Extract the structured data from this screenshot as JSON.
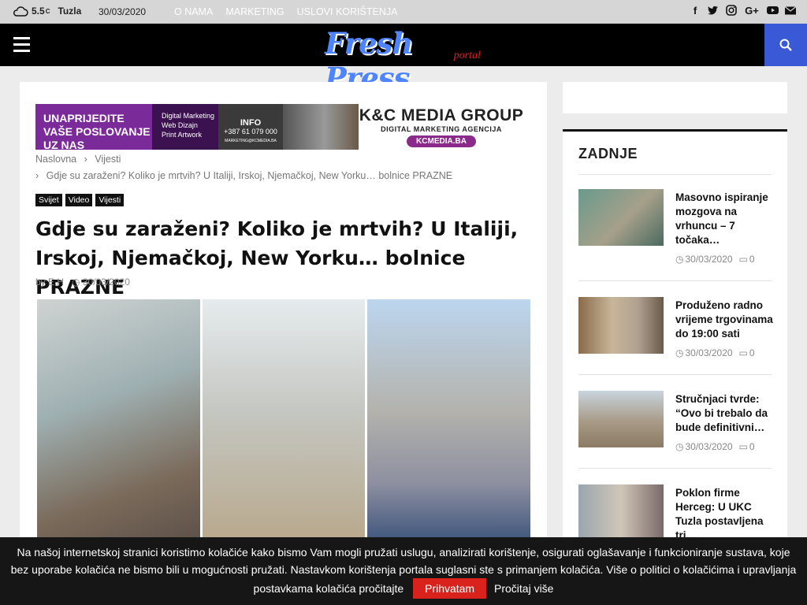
{
  "topbar": {
    "temp": "5.5",
    "temp_unit": "C",
    "city": "Tuzla",
    "date": "30/03/2020",
    "menu": [
      "O NAMA",
      "MARKETING",
      "USLOVI KORIŠTENJA"
    ]
  },
  "header": {
    "logo_main": "Fresh Press",
    "logo_sub": "portal"
  },
  "ad": {
    "headline": "UNAPRIJEDITE VAŠE POSLOVANJE UZ NAS",
    "services": [
      "Digital Marketing",
      "Web Dizajn",
      "Print Artwork"
    ],
    "info_label": "INFO",
    "phone": "+387 61 079 000",
    "email": "MARKETING@KCMEDIA.BA",
    "brand": "K&C MEDIA GROUP",
    "brand_sub": "DIGITAL MARKETING AGENCIJA",
    "brand_url": "KCMEDIA.BA"
  },
  "breadcrumb": {
    "home": "Naslovna",
    "section": "Vijesti",
    "current": "Gdje su zaraženi? Koliko je mrtvih? U Italiji, Irskoj, Njemačkoj, New Yorku… bolnice PRAZNE"
  },
  "article": {
    "tags": [
      "Svijet",
      "Video",
      "Vijesti"
    ],
    "title": "Gdje su zaraženi? Koliko je mrtvih? U Italiji, Irskoj, Njemačkoj, New Yorku… bolnice PRAZNE",
    "author": "by E.H",
    "date": "30/03/2020"
  },
  "sidebar": {
    "heading": "ZADNJE",
    "items": [
      {
        "title": "Masovno ispiranje mozgova na vrhuncu – 7 točaka…",
        "date": "30/03/2020",
        "comments": "0"
      },
      {
        "title": "Produženo radno vrijeme trgovinama do 19:00 sati",
        "date": "30/03/2020",
        "comments": "0"
      },
      {
        "title": "Stručnjaci tvrde: “Ovo bi trebalo da bude definitivni…",
        "date": "30/03/2020",
        "comments": "0"
      },
      {
        "title": "Poklon firme Herceg: U UKC Tuzla postavljena tri…",
        "date": "",
        "comments": ""
      }
    ]
  },
  "cookie": {
    "text": "Na našoj internetskoj stranici koristimo kolačiće kako bismo Vam mogli pružati uslugu, analizirati korištenje, osigurati oglašavanje i funkcioniranje sustava, koje bez uporabe kolačića ne bismo bili u mogućnosti pružati. Nastavkom korištenja portala suglasni ste s primanjem kolačića. Više o politici o kolačićima i upravljanja postavkama kolačića pročitajte",
    "accept": "Prihvatam",
    "more": "Pročitaj više"
  }
}
